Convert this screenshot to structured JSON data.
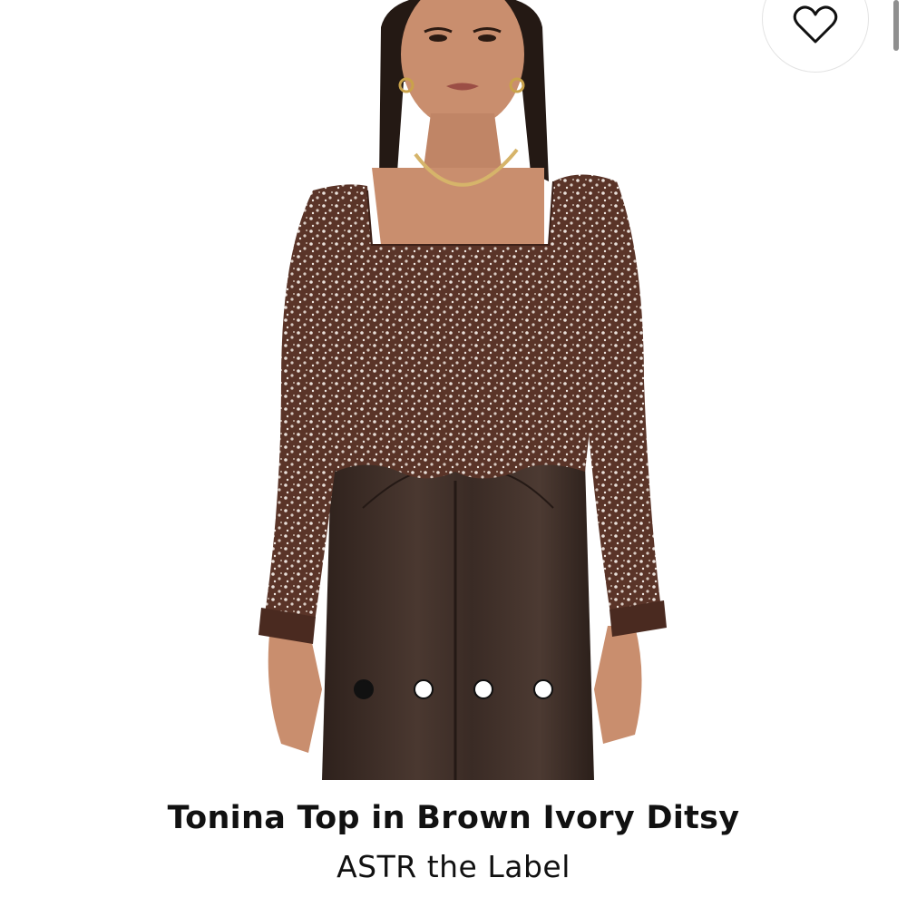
{
  "product": {
    "title": "Tonina Top in Brown Ivory Ditsy",
    "brand": "ASTR the Label"
  },
  "wishlist": {
    "icon": "heart-outline-icon"
  },
  "carousel": {
    "total_images": 4,
    "active_index": 0
  },
  "colors": {
    "text": "#111111",
    "background": "#ffffff",
    "blouse": "#5a3428",
    "pants": "#3a2a24",
    "skin": "#c98e6e",
    "hair": "#241914"
  }
}
